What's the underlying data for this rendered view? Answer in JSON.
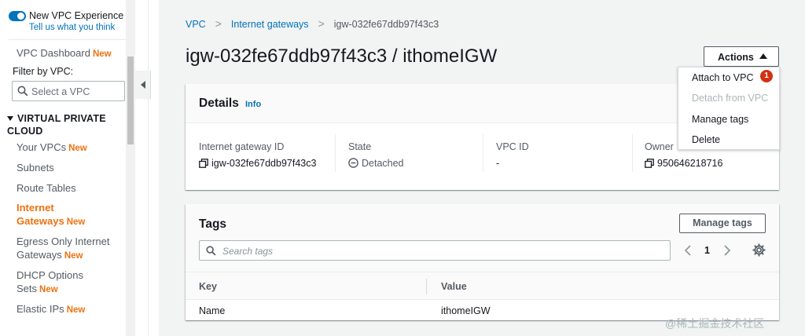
{
  "sidebar": {
    "experience_title": "New VPC Experience",
    "experience_link": "Tell us what you think",
    "dashboard_label": "VPC Dashboard",
    "new_badge": "New",
    "filter_label": "Filter by VPC:",
    "select_placeholder": "Select a VPC",
    "section_title": "VIRTUAL PRIVATE CLOUD",
    "items": [
      {
        "label": "Your VPCs",
        "new": "New"
      },
      {
        "label": "Subnets",
        "new": ""
      },
      {
        "label": "Route Tables",
        "new": ""
      },
      {
        "label": "Internet Gateways",
        "new": "New"
      },
      {
        "label": "Egress Only Internet Gateways",
        "new": "New"
      },
      {
        "label": "DHCP Options Sets",
        "new": "New"
      },
      {
        "label": "Elastic IPs",
        "new": "New"
      }
    ]
  },
  "breadcrumb": {
    "items": [
      "VPC",
      "Internet gateways",
      "igw-032fe67ddb97f43c3"
    ],
    "separator": ">"
  },
  "page": {
    "title": "igw-032fe67ddb97f43c3 / ithomeIGW"
  },
  "actions": {
    "label": "Actions",
    "menu": [
      {
        "label": "Attach to VPC",
        "disabled": false
      },
      {
        "label": "Detach from VPC",
        "disabled": true
      },
      {
        "label": "Manage tags",
        "disabled": false
      },
      {
        "label": "Delete",
        "disabled": false
      }
    ],
    "badge": "1"
  },
  "details": {
    "title": "Details",
    "info": "Info",
    "fields": [
      {
        "label": "Internet gateway ID",
        "value": "igw-032fe67ddb97f43c3"
      },
      {
        "label": "State",
        "value": "Detached"
      },
      {
        "label": "VPC ID",
        "value": "-"
      },
      {
        "label": "Owner",
        "value": "950646218716"
      }
    ]
  },
  "tags": {
    "title": "Tags",
    "manage_label": "Manage tags",
    "search_placeholder": "Search tags",
    "page": "1",
    "columns": [
      "Key",
      "Value"
    ],
    "rows": [
      {
        "key": "Name",
        "value": "ithomeIGW"
      }
    ]
  },
  "watermark": "@稀土掘金技术社区",
  "colors": {
    "accent": "#0073bb",
    "new": "#ec7211",
    "danger": "#d13212"
  }
}
